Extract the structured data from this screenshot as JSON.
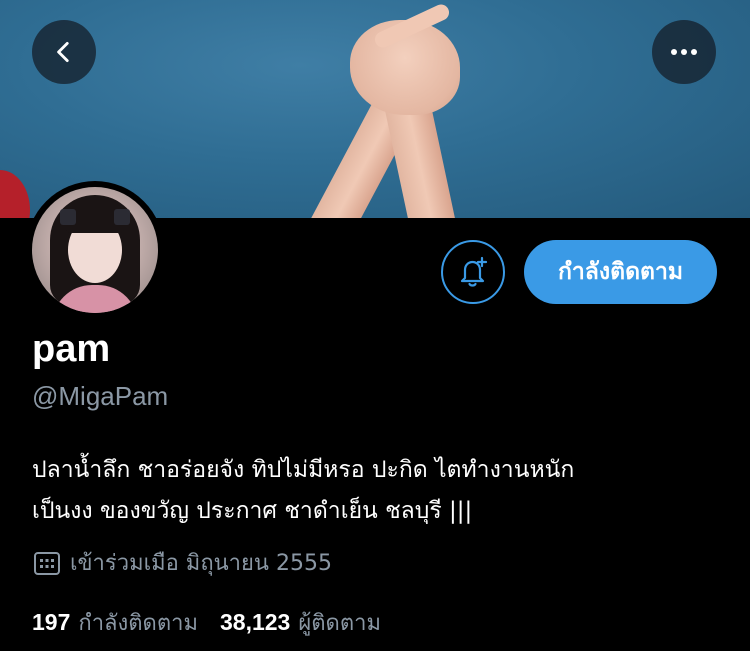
{
  "header": {
    "back_icon": "chevron-left-icon",
    "more_icon": "more-horizontal-icon"
  },
  "profile": {
    "display_name": "pam",
    "handle": "@MigaPam",
    "bio_lines": [
      "ปลาน้ำลึก ชาอร่อยจัง ทิปไม่มีหรอ ปะกิด ไตทำงานหนัก",
      "เป็นงง ของขวัญ ประกาศ ชาดำเย็น ชลบุรี |||"
    ],
    "joined": "เข้าร่วมเมือ มิถุนายน 2555",
    "following_count": "197",
    "following_label": "กำลังติดตาม",
    "followers_count": "38,123",
    "followers_label": "ผู้ติดตาม"
  },
  "actions": {
    "notify_icon": "bell-plus-icon",
    "follow_label": "กำลังติดตาม"
  },
  "colors": {
    "accent": "#3a9ae6",
    "muted_text": "#8b98a5",
    "background": "#000000"
  }
}
